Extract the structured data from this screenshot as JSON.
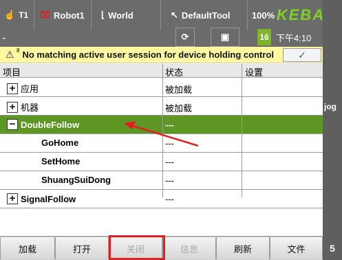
{
  "topbar": {
    "t1": "T1",
    "robot": "Robot1",
    "world": "World",
    "tool": "DefaultTool",
    "percent": "100%",
    "logo": "KEBA",
    "dash": "-",
    "num": "16",
    "time": "下午4:10"
  },
  "warning": {
    "superscript": "8",
    "message": "No matching active user session for device holding control",
    "ok_symbol": "✓"
  },
  "table": {
    "headers": [
      "项目",
      "状态",
      "设置"
    ],
    "rows": [
      {
        "name": "应用",
        "status": "被加载",
        "expander": "+",
        "level": 0,
        "bold": false,
        "selected": false
      },
      {
        "name": "机器",
        "status": "被加载",
        "expander": "+",
        "level": 0,
        "bold": false,
        "selected": false
      },
      {
        "name": "DoubleFollow",
        "status": "---",
        "expander": "−",
        "level": 0,
        "bold": true,
        "selected": true
      },
      {
        "name": "GoHome",
        "status": "---",
        "expander": "",
        "level": 1,
        "bold": true,
        "selected": false
      },
      {
        "name": "SetHome",
        "status": "---",
        "expander": "",
        "level": 1,
        "bold": true,
        "selected": false
      },
      {
        "name": "ShuangSuiDong",
        "status": "---",
        "expander": "",
        "level": 1,
        "bold": true,
        "selected": false
      },
      {
        "name": "SignalFollow",
        "status": "---",
        "expander": "+",
        "level": 0,
        "bold": true,
        "selected": false
      }
    ]
  },
  "side": {
    "jog": "jog",
    "page": "5"
  },
  "buttons": [
    {
      "label": "加载",
      "enabled": true
    },
    {
      "label": "打开",
      "enabled": true
    },
    {
      "label": "关闭",
      "enabled": false
    },
    {
      "label": "信息",
      "enabled": false
    },
    {
      "label": "刷新",
      "enabled": true
    },
    {
      "label": "文件",
      "enabled": true
    }
  ],
  "colors": {
    "selected_row": "#5e9624",
    "warning_bg": "#fff8a0",
    "annotation": "#e02020",
    "logo": "#7ed321"
  }
}
